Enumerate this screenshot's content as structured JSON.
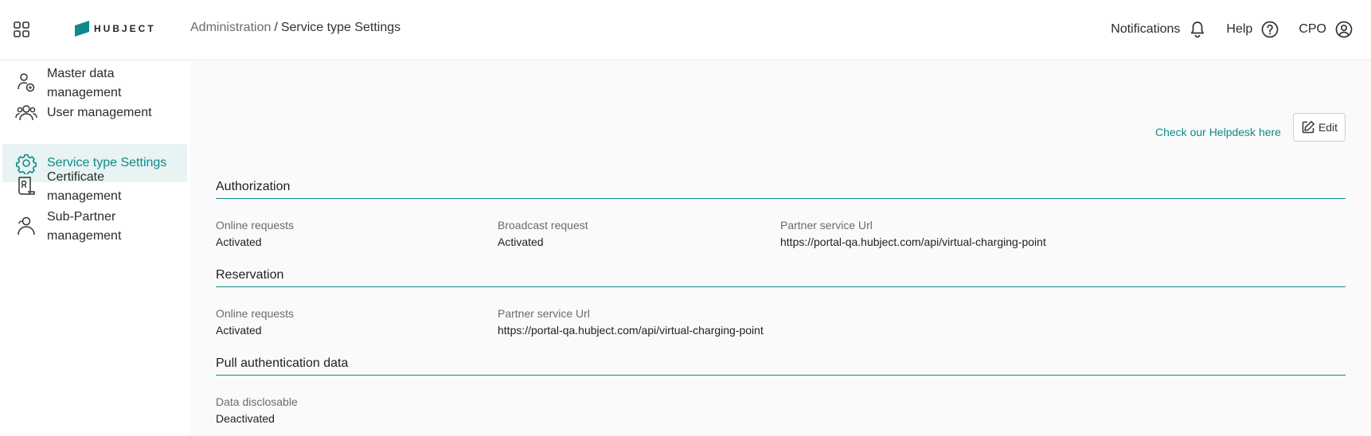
{
  "header": {
    "logo_text": "HUBJECT",
    "breadcrumb_parent": "Administration",
    "breadcrumb_separator": "/",
    "breadcrumb_current": "Service type Settings",
    "notifications_label": "Notifications",
    "help_label": "Help",
    "user_label": "CPO"
  },
  "sidebar": {
    "items": [
      {
        "line1": "Master data",
        "line2": "management",
        "icon": "master-data-icon"
      },
      {
        "line1": "User management",
        "line2": "",
        "icon": "users-icon"
      },
      {
        "line1": "Service type Settings",
        "line2": "",
        "icon": "gear-icon"
      },
      {
        "line1": "Certificate",
        "line2": "management",
        "icon": "certificate-icon"
      },
      {
        "line1": "Sub-Partner",
        "line2": "management",
        "icon": "sub-partner-icon"
      }
    ]
  },
  "main": {
    "helpdesk_link": "Check our Helpdesk here",
    "edit_label": "Edit",
    "sections": [
      {
        "title": "Authorization",
        "fields": [
          {
            "label": "Online requests",
            "value": "Activated"
          },
          {
            "label": "Broadcast request",
            "value": "Activated"
          },
          {
            "label": "Partner service Url",
            "value": "https://portal-qa.hubject.com/api/virtual-charging-point"
          }
        ]
      },
      {
        "title": "Reservation",
        "fields": [
          {
            "label": "Online requests",
            "value": "Activated"
          },
          {
            "label": "Partner service Url",
            "value": "https://portal-qa.hubject.com/api/virtual-charging-point"
          }
        ]
      },
      {
        "title": "Pull authentication data",
        "fields": [
          {
            "label": "Data disclosable",
            "value": "Deactivated"
          }
        ]
      }
    ]
  },
  "colors": {
    "accent": "#0e8a8a",
    "active_bg": "#e8f3f3",
    "main_bg": "#fafafa"
  }
}
